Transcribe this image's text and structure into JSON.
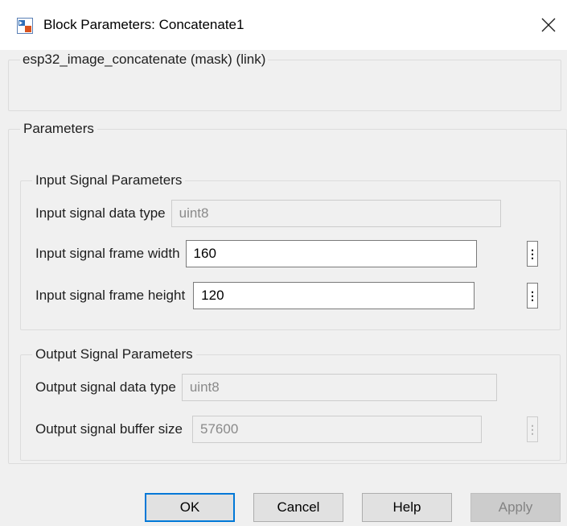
{
  "window": {
    "title": "Block Parameters: Concatenate1"
  },
  "mask": {
    "label": "esp32_image_concatenate (mask) (link)"
  },
  "parameters": {
    "label": "Parameters",
    "input_group": {
      "label": "Input Signal Parameters",
      "data_type": {
        "label": "Input signal data type",
        "value": "uint8"
      },
      "frame_width": {
        "label": "Input signal frame width",
        "value": "160"
      },
      "frame_height": {
        "label": "Input signal frame height",
        "value": "120"
      }
    },
    "output_group": {
      "label": "Output Signal Parameters",
      "data_type": {
        "label": "Output signal data type",
        "value": "uint8"
      },
      "buffer_size": {
        "label": "Output signal buffer size",
        "value": "57600"
      }
    }
  },
  "buttons": {
    "ok": "OK",
    "cancel": "Cancel",
    "help": "Help",
    "apply": "Apply"
  }
}
